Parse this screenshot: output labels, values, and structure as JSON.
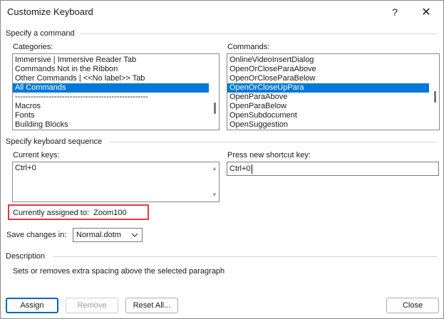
{
  "window": {
    "title": "Customize Keyboard",
    "help": "?",
    "close": "✕"
  },
  "specify_command": {
    "heading": "Specify a command",
    "categories_label": "Categories:",
    "commands_label": "Commands:",
    "categories": [
      "Immersive | Immersive Reader Tab",
      "Commands Not in the Ribbon",
      "Other Commands | <<No label>> Tab",
      "All Commands",
      "---------------------------------------------------",
      "Macros",
      "Fonts",
      "Building Blocks"
    ],
    "categories_selected_index": 3,
    "commands": [
      "OnlineVideoInsertDialog",
      "OpenOrCloseParaAbove",
      "OpenOrCloseParaBelow",
      "OpenOrCloseUpPara",
      "OpenParaAbove",
      "OpenParaBelow",
      "OpenSubdocument",
      "OpenSuggestion"
    ],
    "commands_selected_index": 3
  },
  "keyboard_sequence": {
    "heading": "Specify keyboard sequence",
    "current_keys_label": "Current keys:",
    "current_keys": [
      "Ctrl+0"
    ],
    "new_shortcut_label": "Press new shortcut key:",
    "new_shortcut_value": "Ctrl+0",
    "currently_assigned_label": "Currently assigned to:",
    "currently_assigned_value": "Zoom100"
  },
  "save_changes": {
    "label": "Save changes in:",
    "value": "Normal.dotm"
  },
  "description": {
    "heading": "Description",
    "text": "Sets or removes extra spacing above the selected paragraph"
  },
  "buttons": {
    "assign": "Assign",
    "remove": "Remove",
    "reset_all": "Reset All...",
    "close": "Close"
  },
  "colors": {
    "selection": "#0078d7",
    "highlight_border": "#e23b3b",
    "primary_border": "#0067c0"
  }
}
